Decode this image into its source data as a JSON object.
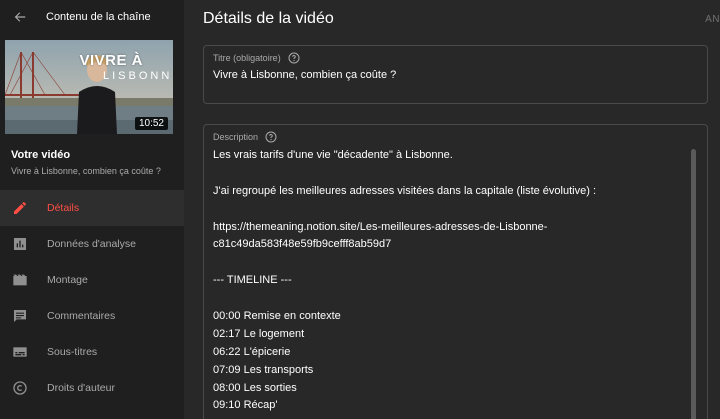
{
  "sidebar": {
    "header_title": "Contenu de la chaîne",
    "thumbnail": {
      "overlay_line1": "VIVRE À",
      "overlay_line2": "LISBONNE",
      "duration": "10:52"
    },
    "your_video_label": "Votre vidéo",
    "video_title": "Vivre à Lisbonne, combien ça coûte ?",
    "nav": [
      {
        "label": "Détails",
        "icon": "pencil-icon",
        "active": true
      },
      {
        "label": "Données d'analyse",
        "icon": "analytics-icon",
        "active": false
      },
      {
        "label": "Montage",
        "icon": "film-icon",
        "active": false
      },
      {
        "label": "Commentaires",
        "icon": "comment-icon",
        "active": false
      },
      {
        "label": "Sous-titres",
        "icon": "subtitles-icon",
        "active": false
      },
      {
        "label": "Droits d'auteur",
        "icon": "copyright-icon",
        "active": false
      }
    ]
  },
  "main": {
    "page_title": "Détails de la vidéo",
    "top_action": "AN",
    "title_field": {
      "label": "Titre (obligatoire)",
      "value": "Vivre à Lisbonne, combien ça coûte ?"
    },
    "description_field": {
      "label": "Description",
      "lines": [
        "Les vrais tarifs d'une vie \"décadente\" à Lisbonne.",
        "",
        "J'ai regroupé les meilleures adresses visitées dans la capitale (liste évolutive) :",
        "",
        "https://themeaning.notion.site/Les-meilleures-adresses-de-Lisbonne-",
        "c81c49da583f48e59fb9cefff8ab59d7",
        "",
        "--- TIMELINE ---",
        "",
        "00:00 Remise en contexte",
        "02:17 Le logement",
        "06:22 L'épicerie",
        "07:09 Les transports",
        "08:00 Les sorties",
        "09:10 Récap'"
      ]
    }
  },
  "colors": {
    "accent": "#ff4e45",
    "sidebar_bg": "#1f1f1f",
    "main_bg": "#282828",
    "muted_text": "#aaaaaa"
  }
}
